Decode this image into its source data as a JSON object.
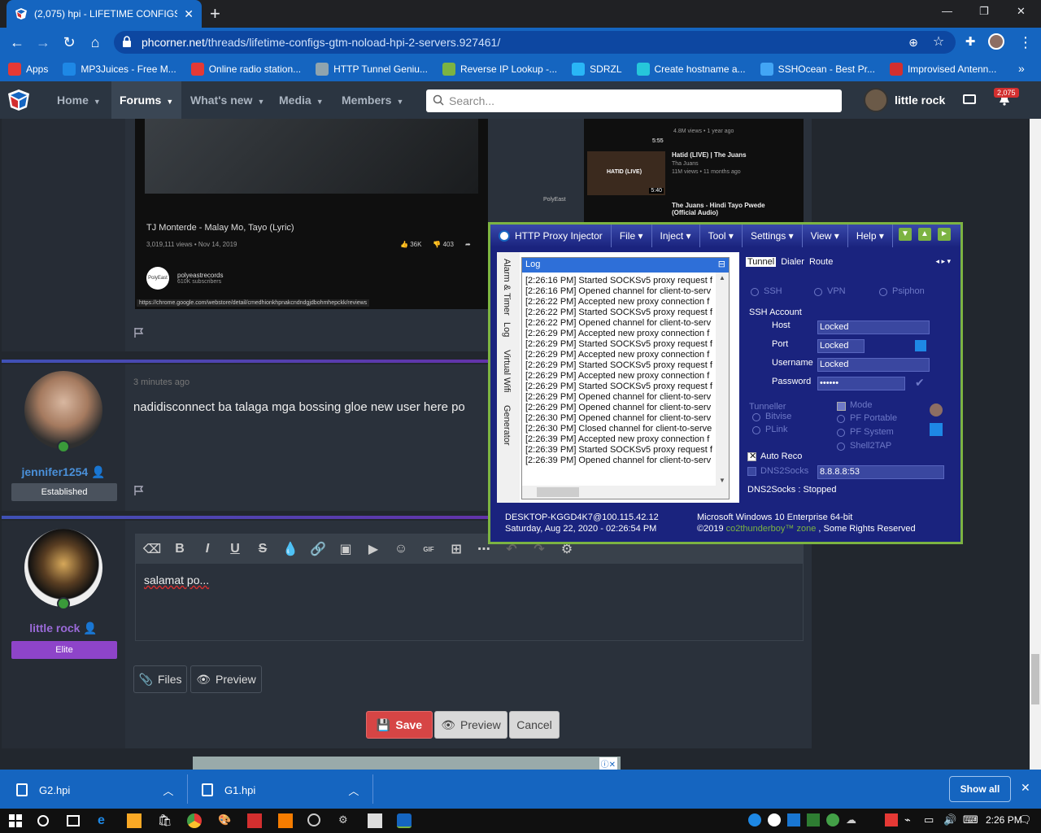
{
  "browser": {
    "tab_title": "(2,075) hpi - LIFETIME CONFIGS",
    "url_host": "phcorner.net",
    "url_path": "/threads/lifetime-configs-gtm-noload-hpi-2-servers.927461/"
  },
  "bookmarks": [
    {
      "label": "Apps",
      "color": "#e53935"
    },
    {
      "label": "MP3Juices - Free M...",
      "color": "#1e88e5"
    },
    {
      "label": "Online radio station...",
      "color": "#e53935"
    },
    {
      "label": "HTTP Tunnel Geniu...",
      "color": "#90a4ae"
    },
    {
      "label": "Reverse IP Lookup -...",
      "color": "#7cb342"
    },
    {
      "label": "SDRZL",
      "color": "#29b6f6"
    },
    {
      "label": "Create hostname a...",
      "color": "#26c6da"
    },
    {
      "label": "SSHOcean - Best Pr...",
      "color": "#42a5f5"
    },
    {
      "label": "Improvised Antenn...",
      "color": "#d32f2f"
    }
  ],
  "forum": {
    "nav": [
      "Home",
      "Forums",
      "What's new",
      "Media",
      "Members"
    ],
    "search_placeholder": "Search...",
    "username": "little rock",
    "alerts": "2,075"
  },
  "video": {
    "title": "TJ Monterde - Malay Mo, Tayo (Lyric)",
    "stats": "3,019,111 views • Nov 14, 2019",
    "likes": "36K",
    "dislikes": "403",
    "channel": "polyeastrecords",
    "subs": "610K subscribers",
    "avatar_text": "PolyEast",
    "link": "https://chrome.google.com/webstore/detail/cmedhionkhpnakcndndgjdbohmhepckk/reviews",
    "side": [
      {
        "title": "Hatid (LIVE) | The Juans",
        "meta": "Tha Juans",
        "views": "11M views • 11 months ago",
        "duration": "5:40",
        "thumb_text": "HATID (LIVE)"
      },
      {
        "title": "The Juans - Hindi Tayo Pwede (Official Audio)",
        "meta": "",
        "views": "4.8M views • 1 year ago",
        "duration": "5:55",
        "thumb_text": ""
      }
    ],
    "watermark": "PolyEast"
  },
  "posts": [
    {
      "time": "3 minutes ago",
      "text": "nadidisconnect ba talaga mga bossing gloe new user here po",
      "user": "jennifer1254",
      "rank": "Established",
      "rank_color": "#4a525d",
      "name_color": "#4a90d9"
    }
  ],
  "reply": {
    "user": "little rock",
    "rank": "Elite",
    "rank_color": "#8e44c9",
    "name_color": "#9a6ad8",
    "text": "salamat po...",
    "files_label": "Files",
    "preview_label": "Preview",
    "save_label": "Save",
    "preview2_label": "Preview",
    "cancel_label": "Cancel"
  },
  "injector": {
    "app_name": "HTTP Proxy Injector",
    "menu": [
      "File",
      "Inject",
      "Tool",
      "Settings",
      "View",
      "Help"
    ],
    "vtabs": [
      "Alarm & Timer",
      "Log",
      "Virtual Wifi",
      "Generator"
    ],
    "log_title": "Log",
    "log": [
      "[2:26:16 PM] Started SOCKSv5 proxy request f",
      "[2:26:16 PM] Opened channel for client-to-serv",
      "[2:26:22 PM] Accepted new proxy connection f",
      "[2:26:22 PM] Started SOCKSv5 proxy request f",
      "[2:26:22 PM] Opened channel for client-to-serv",
      "[2:26:29 PM] Accepted new proxy connection f",
      "[2:26:29 PM] Started SOCKSv5 proxy request f",
      "[2:26:29 PM] Accepted new proxy connection f",
      "[2:26:29 PM] Started SOCKSv5 proxy request f",
      "[2:26:29 PM] Accepted new proxy connection f",
      "[2:26:29 PM] Started SOCKSv5 proxy request f",
      "[2:26:29 PM] Opened channel for client-to-serv",
      "[2:26:29 PM] Opened channel for client-to-serv",
      "[2:26:30 PM] Opened channel for client-to-serv",
      "[2:26:30 PM] Closed channel for client-to-serve",
      "[2:26:39 PM] Accepted new proxy connection f",
      "[2:26:39 PM] Started SOCKSv5 proxy request f",
      "[2:26:39 PM] Opened channel for client-to-serv"
    ],
    "rtabs": [
      "Tunnel",
      "Dialer",
      "Route"
    ],
    "modes": [
      "SSH",
      "VPN",
      "Psiphon"
    ],
    "ssh_account": "SSH Account",
    "host_label": "Host",
    "host": "Locked",
    "port_label": "Port",
    "port": "Locked",
    "user_label": "Username",
    "user": "Locked",
    "pass_label": "Password",
    "pass": "••••••",
    "tunneller": "Tunneller",
    "tunnel_opts": [
      "Bitvise",
      "PLink"
    ],
    "mode_label": "Mode",
    "mode_opts": [
      "PF Portable",
      "PF System",
      "Shell2TAP"
    ],
    "auto_reco": "Auto Reco",
    "dns2socks": "DNS2Socks",
    "dns_value": "8.8.8.8:53",
    "dns_status": "DNS2Socks : Stopped",
    "status_left1": "DESKTOP-KGGD4K7@100.115.42.12",
    "status_left2": "Saturday, Aug 22, 2020 - 02:26:54 PM",
    "status_right1": "Microsoft Windows 10 Enterprise 64-bit",
    "status_right2a": "©2019 ",
    "status_right2b": "co2thunderboy™ zone",
    "status_right2c": " , Some Rights Reserved"
  },
  "downloads": [
    {
      "name": "G2.hpi"
    },
    {
      "name": "G1.hpi"
    }
  ],
  "show_all": "Show all",
  "clock": "2:26 PM"
}
